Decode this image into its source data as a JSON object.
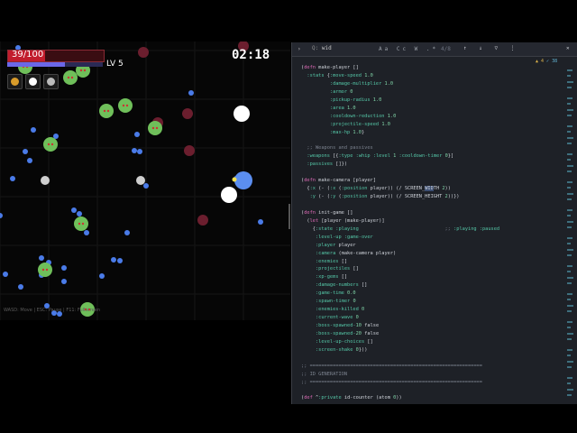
{
  "game": {
    "hp_text": "39/100",
    "hp_fraction": 0.39,
    "xp_fraction": 0.6,
    "level_text": "LV 5",
    "timer": "02:18",
    "weapon_slots": [
      "whip-icon",
      "orb-icon",
      "orb-icon"
    ],
    "controls_hint": "WASD: Move | ESC: Pause | F11: Fullscreen",
    "colors": {
      "enemy": "#6fbf5a",
      "enemy_eye": "#c33",
      "gem": "#4a7be8",
      "player": "#5b8ef0",
      "projectile": "#ffffff",
      "dark_enemy": "#6b1e2e"
    }
  },
  "editor": {
    "find": {
      "chevron": "›",
      "label": "Q:",
      "query": "wid",
      "options": "Aa Cc W .*",
      "count": "4/8",
      "nav": "↑ ↓ ▽ ⋮",
      "close": "✕"
    },
    "problems": {
      "warnings": "▲ 4",
      "checks": "✓ 38"
    },
    "code_lines": [
      "(defn make-player []",
      "  :stats {:move-speed 1.0",
      "          :damage-multiplier 1.0",
      "          :armor 0",
      "          :pickup-radius 1.0",
      "          :area 1.0",
      "          :cooldown-reduction 1.0",
      "          :projectile-speed 1.0",
      "          :max-hp 1.0}",
      "",
      "  ;; Weapons and passives",
      "  :weapons [{:type :whip :level 1 :cooldown-timer 0}]",
      "  :passives []})",
      "",
      "(defn make-camera [player]",
      "  {:x (- (:x (:position player)) (/ SCREEN_WIDTH 2))",
      "   :y (- (:y (:position player)) (/ SCREEN_HEIGHT 2))})",
      "",
      "(defn init-game []",
      "  (let [player (make-player)]",
      "    {:state :playing                              ;; :playing :paused",
      "     :level-up :game-over",
      "     :player player",
      "     :camera (make-camera player)",
      "     :enemies []",
      "     :projectiles []",
      "     :xp-gems []",
      "     :damage-numbers []",
      "     :game-time 0.0",
      "     :spawn-timer 0",
      "     :enemies-killed 0",
      "     :current-wave 0",
      "     :boss-spawned-10 false",
      "     :boss-spawned-20 false",
      "     :level-up-choices []",
      "     :screen-shake 0}))",
      "",
      ";; ============================================================",
      ";; ID GENERATION",
      ";; ============================================================",
      "",
      "(def ^:private id-counter (atom 0))"
    ]
  }
}
